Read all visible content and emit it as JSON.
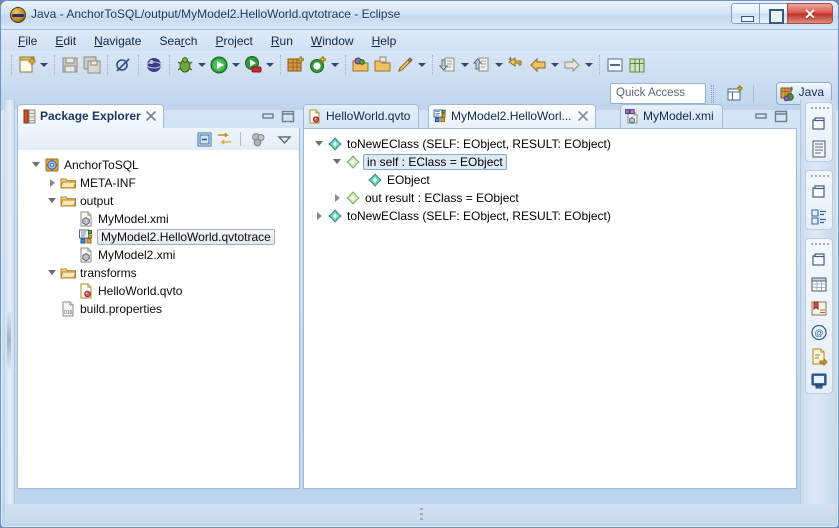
{
  "window": {
    "title": "Java - AnchorToSQL/output/MyModel2.HelloWorld.qvtotrace - Eclipse",
    "minimize_label": "Minimize",
    "maximize_label": "Maximize",
    "close_label": "Close",
    "close_glyph": "✕"
  },
  "menubar": {
    "items": [
      {
        "label": "File",
        "mnemonic": "F"
      },
      {
        "label": "Edit",
        "mnemonic": "E"
      },
      {
        "label": "Navigate",
        "mnemonic": "N"
      },
      {
        "label": "Search",
        "mnemonic": "r"
      },
      {
        "label": "Project",
        "mnemonic": "P"
      },
      {
        "label": "Run",
        "mnemonic": "R"
      },
      {
        "label": "Window",
        "mnemonic": "W"
      },
      {
        "label": "Help",
        "mnemonic": "H"
      }
    ]
  },
  "toolbar": {
    "items": [
      {
        "name": "new-wizard",
        "tooltip": "New"
      },
      {
        "name": "new-dropdown",
        "tooltip": "New menu"
      },
      {
        "name": "save",
        "tooltip": "Save"
      },
      {
        "name": "save-all",
        "tooltip": "Save All"
      },
      {
        "name": "toggle-breakpoint",
        "tooltip": "Skip All Breakpoints"
      },
      {
        "name": "open-browser",
        "tooltip": "Open Web Browser"
      },
      {
        "name": "debug",
        "tooltip": "Debug"
      },
      {
        "name": "debug-dropdown",
        "tooltip": "Debug menu"
      },
      {
        "name": "run",
        "tooltip": "Run"
      },
      {
        "name": "run-dropdown",
        "tooltip": "Run menu"
      },
      {
        "name": "external-tools",
        "tooltip": "External Tools"
      },
      {
        "name": "external-tools-dropdown",
        "tooltip": "External Tools menu"
      },
      {
        "name": "new-java-package",
        "tooltip": "New Java Package"
      },
      {
        "name": "new-java-class",
        "tooltip": "New Java Class"
      },
      {
        "name": "new-java-class-dropdown",
        "tooltip": "New Java Class menu"
      },
      {
        "name": "open-type",
        "tooltip": "Open Type"
      },
      {
        "name": "open-task",
        "tooltip": "Open Task"
      },
      {
        "name": "search",
        "tooltip": "Search"
      },
      {
        "name": "search-dropdown",
        "tooltip": "Search menu"
      },
      {
        "name": "next-annotation",
        "tooltip": "Next Annotation"
      },
      {
        "name": "next-annotation-dropdown",
        "tooltip": "Next Annotation menu"
      },
      {
        "name": "previous-annotation",
        "tooltip": "Previous Annotation"
      },
      {
        "name": "previous-annotation-dropdown",
        "tooltip": "Previous Annotation menu"
      },
      {
        "name": "last-edit-location",
        "tooltip": "Last Edit Location"
      },
      {
        "name": "back",
        "tooltip": "Back"
      },
      {
        "name": "back-dropdown",
        "tooltip": "Back menu"
      },
      {
        "name": "forward",
        "tooltip": "Forward"
      },
      {
        "name": "forward-dropdown",
        "tooltip": "Forward menu"
      },
      {
        "name": "restore-view",
        "tooltip": "Restore"
      },
      {
        "name": "open-perspective-grid",
        "tooltip": "Open Perspective"
      }
    ]
  },
  "quick_access": {
    "placeholder": "Quick Access",
    "value": "Quick Access"
  },
  "perspective": {
    "open_label": "Open Perspective",
    "current": "Java"
  },
  "package_explorer": {
    "title": "Package Explorer",
    "close_glyph": "✕",
    "toolbar": [
      {
        "name": "collapse-all-icon",
        "tooltip": "Collapse All"
      },
      {
        "name": "link-with-editor-icon",
        "tooltip": "Link with Editor"
      },
      {
        "name": "focus-on-active-task-icon",
        "tooltip": "Focus on Active Task"
      },
      {
        "name": "view-menu-icon",
        "tooltip": "View Menu"
      }
    ],
    "tree": [
      {
        "label": "AnchorToSQL",
        "depth": 0,
        "twist": "expanded",
        "icon": "java-project-icon",
        "selected": false
      },
      {
        "label": "META-INF",
        "depth": 1,
        "twist": "collapsed",
        "icon": "folder-icon",
        "selected": false
      },
      {
        "label": "output",
        "depth": 1,
        "twist": "expanded",
        "icon": "folder-icon",
        "selected": false
      },
      {
        "label": "MyModel.xmi",
        "depth": 2,
        "twist": "none",
        "icon": "xmi-file-icon",
        "selected": false
      },
      {
        "label": "MyModel2.HelloWorld.qvtotrace",
        "depth": 2,
        "twist": "none",
        "icon": "qvtotrace-file-icon",
        "selected": true
      },
      {
        "label": "MyModel2.xmi",
        "depth": 2,
        "twist": "none",
        "icon": "xmi-file-icon",
        "selected": false
      },
      {
        "label": "transforms",
        "depth": 1,
        "twist": "expanded",
        "icon": "folder-icon",
        "selected": false
      },
      {
        "label": "HelloWorld.qvto",
        "depth": 2,
        "twist": "none",
        "icon": "qvto-file-icon",
        "selected": false
      },
      {
        "label": "build.properties",
        "depth": 1,
        "twist": "none",
        "icon": "properties-file-icon",
        "selected": false
      }
    ]
  },
  "editor": {
    "tabs": [
      {
        "label": "HelloWorld.qvto",
        "icon": "qvto-file-icon",
        "active": false,
        "closable": false
      },
      {
        "label": "MyModel2.HelloWorl...",
        "icon": "qvtotrace-file-icon",
        "active": true,
        "closable": true,
        "close_glyph": "✕"
      },
      {
        "label": "MyModel.xmi",
        "icon": "xmi-editor-icon",
        "active": false,
        "closable": false
      }
    ],
    "minimize_tooltip": "Minimize",
    "maximize_tooltip": "Maximize",
    "tree": [
      {
        "label": "toNewEClass (SELF: EObject, RESULT: EObject)",
        "depth": 0,
        "twist": "expanded",
        "icon": "trace-record-icon",
        "selected": false
      },
      {
        "label": "in self : EClass = EObject",
        "depth": 1,
        "twist": "expanded",
        "icon": "var-pale-icon",
        "selected": true
      },
      {
        "label": "EObject",
        "depth": 2,
        "twist": "none",
        "icon": "trace-record-icon",
        "selected": false
      },
      {
        "label": "out result : EClass = EObject",
        "depth": 1,
        "twist": "collapsed",
        "icon": "var-pale-icon",
        "selected": false
      },
      {
        "label": "toNewEClass (SELF: EObject, RESULT: EObject)",
        "depth": 0,
        "twist": "collapsed",
        "icon": "trace-record-icon",
        "selected": false
      }
    ]
  },
  "fast_view_bar": {
    "groups": [
      {
        "icons": [
          "restore-icon",
          "outline-view-icon"
        ]
      },
      {
        "icons": [
          "restore-icon",
          "properties-view-icon"
        ]
      },
      {
        "icons": [
          "restore-icon",
          "table-view-icon",
          "bookmarks-view-icon",
          "internal-browser-icon",
          "tasks-view-icon",
          "console-view-icon"
        ]
      }
    ]
  },
  "colors": {
    "window_border": "#6f93c0",
    "title_text": "#13325c",
    "accent_blue": "#3c6ea5",
    "selection_fill": "#dfeaf7",
    "selection_border": "#7fa8cf",
    "folder_orange": "#e8a33d",
    "tree_text": "#000000",
    "close_red": "#c0392b"
  }
}
